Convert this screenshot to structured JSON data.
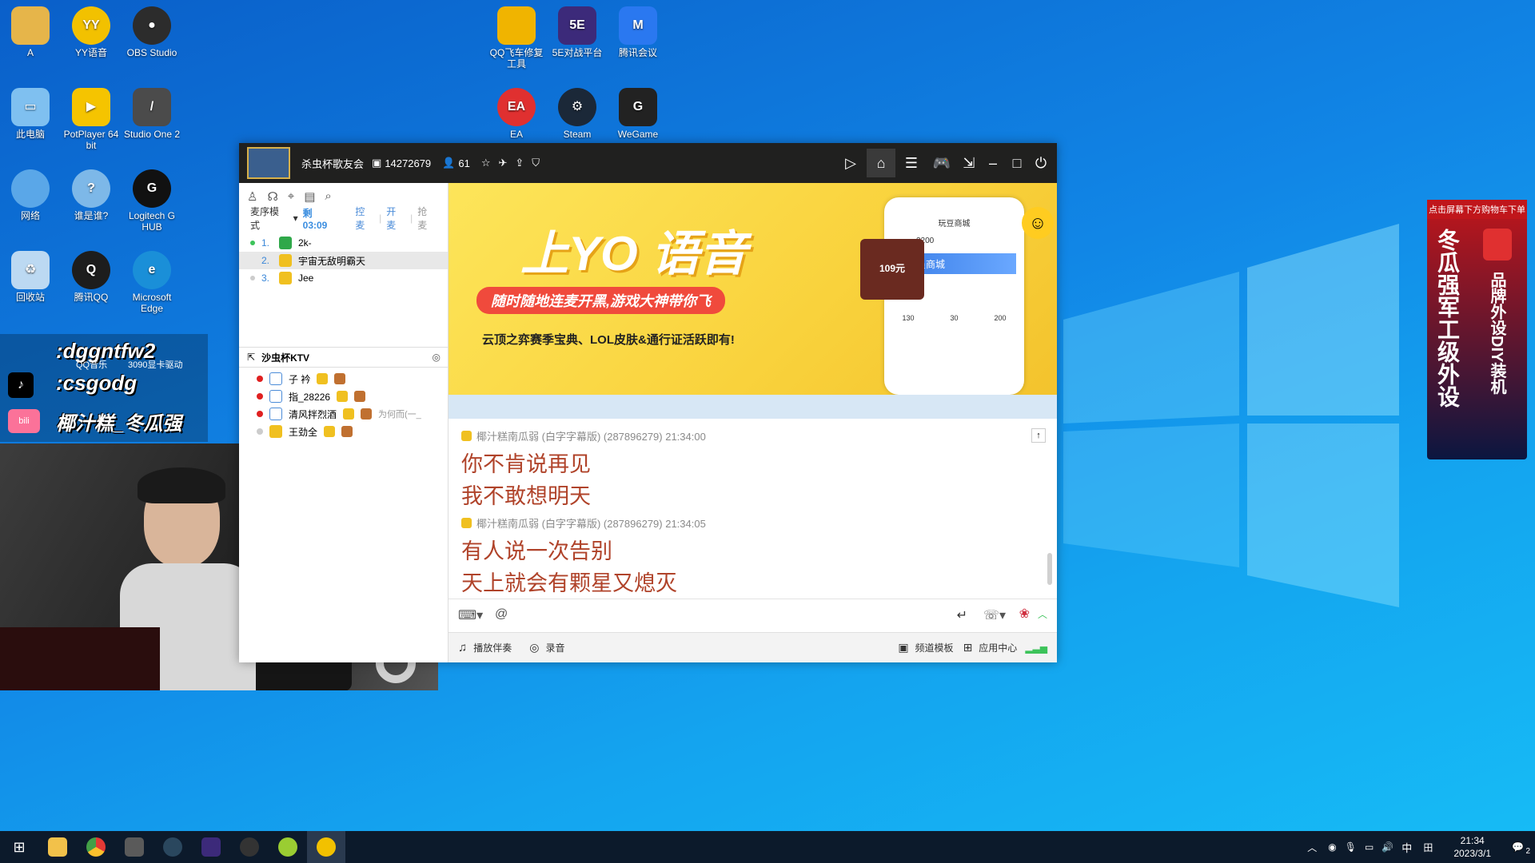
{
  "desktop": {
    "icons": [
      {
        "label": "A",
        "color": "#e6b54a"
      },
      {
        "label": "YY语音",
        "color": "#f2c100"
      },
      {
        "label": "OBS Studio",
        "color": "#2c2c2c"
      },
      {
        "label": "QQ飞车修复工具",
        "color": "#f0b400"
      },
      {
        "label": "5E对战平台",
        "color": "#3c2a7a"
      },
      {
        "label": "腾讯会议",
        "color": "#2a78f0"
      },
      {
        "label": "此电脑",
        "color": "#7fc0f0"
      },
      {
        "label": "PotPlayer 64 bit",
        "color": "#f5c400"
      },
      {
        "label": "Studio One 2",
        "color": "#4b4b4b"
      },
      {
        "label": "EA",
        "color": "#e03030"
      },
      {
        "label": "Steam",
        "color": "#1b2838"
      },
      {
        "label": "WeGame",
        "color": "#222222"
      },
      {
        "label": "网络",
        "color": "#5aa7e8"
      },
      {
        "label": "谁是谁?",
        "color": "#7db8e8"
      },
      {
        "label": "Logitech G HUB",
        "color": "#111111"
      },
      {
        "label": "回收站",
        "color": "#bcd9f2"
      },
      {
        "label": "腾讯QQ",
        "color": "#1d1d1d"
      },
      {
        "label": "Microsoft Edge",
        "color": "#1a8fd8"
      }
    ],
    "overlay_lines": [
      ":dggntfw2",
      ":csgodg",
      "椰汁糕_冬瓜强"
    ],
    "overlay_under": [
      "QQ音乐",
      "3090显卡驱动"
    ]
  },
  "yy": {
    "channel_name": "杀虫杯歌友会",
    "channel_id": "14272679",
    "online_count": "61",
    "mode_label": "麦序模式",
    "timer": "剩 03:09",
    "mic_actions": [
      "控麦",
      "开麦",
      "抢麦"
    ],
    "queue": [
      {
        "num": "1.",
        "name": "2k-"
      },
      {
        "num": "2.",
        "name": "宇宙无敌明霸天"
      },
      {
        "num": "3.",
        "name": "Jee"
      }
    ],
    "subchannel": "沙虫杯KTV",
    "members": [
      {
        "name": "子 衿",
        "note": ""
      },
      {
        "name": "指_28226",
        "note": ""
      },
      {
        "name": "清风拌烈酒",
        "note": "为何而(一_"
      },
      {
        "name": "王劲全",
        "note": ""
      }
    ],
    "banner": {
      "title": "上YO 语音",
      "ribbon": "随时随地连麦开黑,游戏大神带你飞",
      "sub": "云顶之弈赛季宝典、LOL皮肤&通行证活跃即有!",
      "phone_title": "玩豆商城",
      "phone_badge": "109元",
      "phone_balance": "3200",
      "phone_store": "员商城",
      "phone_vals": [
        "130",
        "30",
        "200"
      ]
    },
    "messages": [
      {
        "sender": "椰汁糕南瓜弱 (白字字幕版) (287896279) 21:34:00",
        "lines": [
          "你不肯说再见",
          "我不敢想明天"
        ]
      },
      {
        "sender": "椰汁糕南瓜弱 (白字字幕版) (287896279) 21:34:05",
        "lines": [
          "有人说一次告别",
          "天上就会有颗星又熄灭"
        ]
      }
    ],
    "bottom": {
      "play_music": "播放伴奏",
      "record": "录音",
      "template": "频道模板",
      "app_center": "应用中心"
    }
  },
  "ad": {
    "top": "点击屏幕下方购物车下单",
    "big": "冬瓜强军工级外设",
    "small": "品牌外设DIY装机"
  },
  "taskbar": {
    "time": "21:34",
    "date": "2023/3/1",
    "ime": "中",
    "notif": "2",
    "apps": [
      "start",
      "explorer",
      "chrome",
      "studio",
      "steam",
      "5e",
      "obs",
      "xbox",
      "yy"
    ]
  }
}
